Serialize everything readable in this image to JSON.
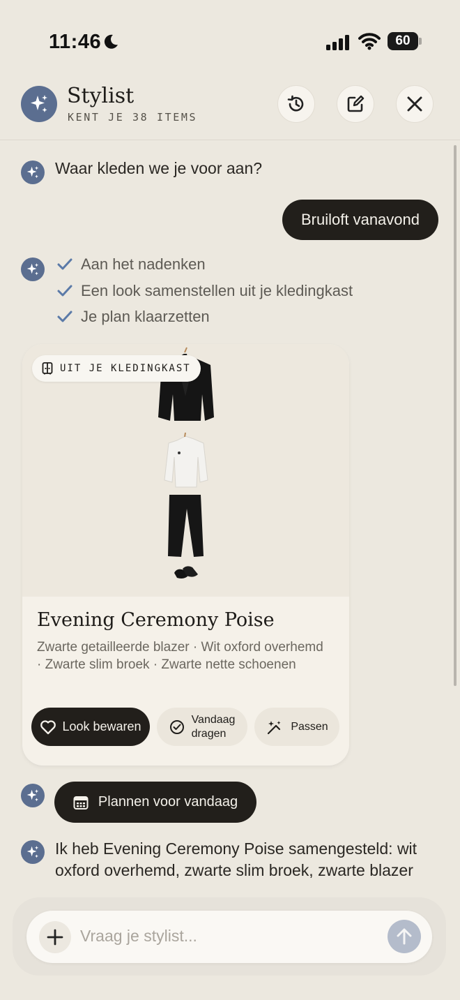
{
  "status_bar": {
    "time": "11:46",
    "battery": "60"
  },
  "header": {
    "title": "Stylist",
    "subtitle": "KENT JE 38 ITEMS"
  },
  "chat": {
    "assistant_question": "Waar kleden we je voor aan?",
    "user_message": "Bruiloft vanavond",
    "steps": [
      "Aan het nadenken",
      "Een look samenstellen uit je kledingkast",
      "Je plan klaarzetten"
    ],
    "outfit_card": {
      "tag": "UIT JE KLEDINGKAST",
      "title": "Evening Ceremony Poise",
      "description": "Zwarte getailleerde blazer · Wit oxford overhemd · Zwarte slim broek · Zwarte nette schoenen",
      "buttons": {
        "save": "Look bewaren",
        "wear_today_line1": "Vandaag",
        "wear_today_line2": "dragen",
        "fit": "Passen"
      }
    },
    "plan_button": "Plannen voor vandaag",
    "summary": "Ik heb Evening Ceremony Poise samengesteld: wit oxford overhemd, zwarte slim broek, zwarte blazer"
  },
  "composer": {
    "placeholder": "Vraag je stylist..."
  },
  "colors": {
    "accent": "#5b6e90",
    "dark": "#221f1b",
    "background": "#ece8df",
    "check": "#5b7aa8"
  }
}
